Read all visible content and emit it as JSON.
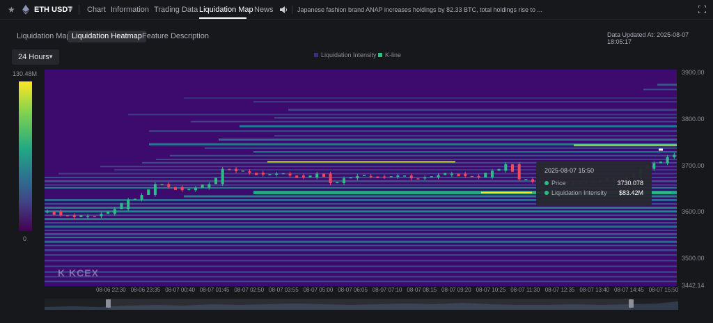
{
  "header": {
    "pair": "ETH USDT",
    "tabs": [
      {
        "label": "Chart"
      },
      {
        "label": "Information"
      },
      {
        "label": "Trading Data"
      },
      {
        "label": "Liquidation Map"
      },
      {
        "label": "News"
      }
    ],
    "active_tab": "Liquidation Map",
    "ticker": "Japanese fashion brand ANAP increases holdings by 82.33 BTC, total holdings rise to ..."
  },
  "subtabs": [
    {
      "label": "Liquidation Map"
    },
    {
      "label": "Liquidation Heatmap"
    },
    {
      "label": "Feature Description"
    }
  ],
  "active_subtab": "Liquidation Heatmap",
  "updated": {
    "label": "Data Updated At:",
    "value": "2025-08-07 18:05:17"
  },
  "range": {
    "selected": "24 Hours"
  },
  "legend": [
    {
      "label": "Liquidation Intensity",
      "color": "#3b2f7a"
    },
    {
      "label": "K-line",
      "color": "#2ebd85"
    }
  ],
  "colorbar": {
    "max": "130.48M",
    "min": "0"
  },
  "watermark": "KCEX",
  "tooltip": {
    "time": "2025-08-07 15:50",
    "price_label": "Price",
    "price_value": "3730.078",
    "intensity_label": "Liquidation Intensity",
    "intensity_value": "$83.42M"
  },
  "chart_data": {
    "type": "heatmap",
    "title": "",
    "y_ticks": [
      "3900.00",
      "3800.00",
      "3700.00",
      "3600.00",
      "3500.00",
      "3442.14"
    ],
    "ylim": [
      3442.14,
      3900
    ],
    "x_ticks": [
      "08-06 22:30",
      "08-06 23:35",
      "08-07 00:40",
      "08-07 01:45",
      "08-07 02:50",
      "08-07 03:55",
      "08-07 05:00",
      "08-07 06:05",
      "08-07 07:10",
      "08-07 08:15",
      "08-07 09:20",
      "08-07 10:25",
      "08-07 11:30",
      "08-07 12:35",
      "08-07 13:40",
      "08-07 14:45",
      "08-07 15:50"
    ],
    "colorscale": [
      "#440154",
      "#414487",
      "#2a788e",
      "#22a884",
      "#7ad151",
      "#fde725"
    ],
    "kline_close_points": [
      [
        0,
        3600
      ],
      [
        2,
        3592
      ],
      [
        4,
        3588
      ],
      [
        6,
        3590
      ],
      [
        8,
        3595
      ],
      [
        10,
        3605
      ],
      [
        12,
        3625
      ],
      [
        14,
        3635
      ],
      [
        16,
        3658
      ],
      [
        18,
        3652
      ],
      [
        20,
        3645
      ],
      [
        22,
        3650
      ],
      [
        24,
        3658
      ],
      [
        26,
        3690
      ],
      [
        28,
        3685
      ],
      [
        30,
        3682
      ],
      [
        32,
        3678
      ],
      [
        34,
        3680
      ],
      [
        36,
        3676
      ],
      [
        38,
        3672
      ],
      [
        40,
        3680
      ],
      [
        42,
        3660
      ],
      [
        44,
        3670
      ],
      [
        46,
        3675
      ],
      [
        48,
        3674
      ],
      [
        50,
        3673
      ],
      [
        52,
        3676
      ],
      [
        54,
        3670
      ],
      [
        56,
        3672
      ],
      [
        58,
        3677
      ],
      [
        60,
        3680
      ],
      [
        62,
        3675
      ],
      [
        64,
        3672
      ],
      [
        66,
        3686
      ],
      [
        68,
        3700
      ],
      [
        70,
        3668
      ],
      [
        72,
        3663
      ],
      [
        74,
        3660
      ],
      [
        76,
        3658
      ],
      [
        78,
        3660
      ],
      [
        80,
        3662
      ],
      [
        82,
        3665
      ],
      [
        84,
        3668
      ],
      [
        86,
        3672
      ],
      [
        88,
        3690
      ],
      [
        90,
        3702
      ],
      [
        92,
        3715
      ],
      [
        93,
        3720
      ]
    ]
  }
}
